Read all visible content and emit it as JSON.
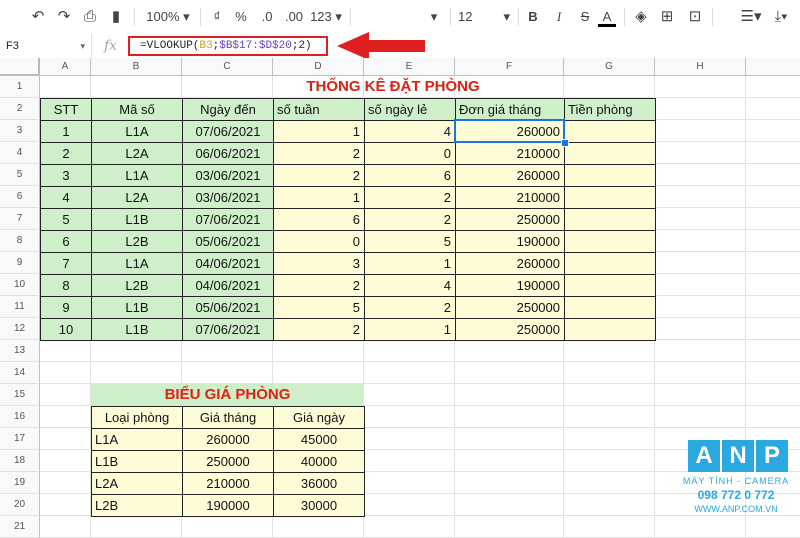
{
  "toolbar": {
    "zoom": "100%",
    "currency": "₫",
    "percent": "%",
    "dec_decrease": ".0",
    "dec_increase": ".00",
    "more_formats": "123",
    "font_size": "12",
    "bold": "B",
    "italic": "I",
    "strike": "S",
    "text_color": "A"
  },
  "formula_bar": {
    "cell_ref": "F3",
    "fx": "fx",
    "formula_prefix": "=VLOOKUP(",
    "formula_ref1": "B3",
    "formula_sep": ";",
    "formula_ref2": "$B$17:$D$20",
    "formula_suffix": ";2)"
  },
  "columns": [
    "A",
    "B",
    "C",
    "D",
    "E",
    "F",
    "G",
    "H"
  ],
  "rows": [
    "1",
    "2",
    "3",
    "4",
    "5",
    "6",
    "7",
    "8",
    "9",
    "10",
    "11",
    "12",
    "13",
    "14",
    "15",
    "16",
    "17",
    "18",
    "19",
    "20",
    "21"
  ],
  "main_table": {
    "title": "THỐNG KÊ ĐẶT PHÒNG",
    "headers": [
      "STT",
      "Mã số",
      "Ngày đến",
      "số tuần",
      "số ngày lẻ",
      "Đơn giá tháng",
      "Tiền phòng"
    ],
    "rows": [
      [
        "1",
        "L1A",
        "07/06/2021",
        "1",
        "4",
        "260000",
        ""
      ],
      [
        "2",
        "L2A",
        "06/06/2021",
        "2",
        "0",
        "210000",
        ""
      ],
      [
        "3",
        "L1A",
        "03/06/2021",
        "2",
        "6",
        "260000",
        ""
      ],
      [
        "4",
        "L2A",
        "03/06/2021",
        "1",
        "2",
        "210000",
        ""
      ],
      [
        "5",
        "L1B",
        "07/06/2021",
        "6",
        "2",
        "250000",
        ""
      ],
      [
        "6",
        "L2B",
        "05/06/2021",
        "0",
        "5",
        "190000",
        ""
      ],
      [
        "7",
        "L1A",
        "04/06/2021",
        "3",
        "1",
        "260000",
        ""
      ],
      [
        "8",
        "L2B",
        "04/06/2021",
        "2",
        "4",
        "190000",
        ""
      ],
      [
        "9",
        "L1B",
        "05/06/2021",
        "5",
        "2",
        "250000",
        ""
      ],
      [
        "10",
        "L1B",
        "07/06/2021",
        "2",
        "1",
        "250000",
        ""
      ]
    ]
  },
  "price_table": {
    "title": "BIỂU GIÁ PHÒNG",
    "headers": [
      "Loại phòng",
      "Giá tháng",
      "Giá ngày"
    ],
    "rows": [
      [
        "L1A",
        "260000",
        "45000"
      ],
      [
        "L1B",
        "250000",
        "40000"
      ],
      [
        "L2A",
        "210000",
        "36000"
      ],
      [
        "L2B",
        "190000",
        "30000"
      ]
    ]
  },
  "logo": {
    "letters": [
      "A",
      "N",
      "P"
    ],
    "tagline": "MÁY TÍNH - CAMERA",
    "phone": "098 772 0 772",
    "site": "WWW.ANP.COM.VN"
  },
  "colors": {
    "header_green": "#cfefcb",
    "data_yellow": "#fefbd7",
    "title_red": "#e02010",
    "annotation_red": "#e02020",
    "selection_blue": "#1a73e8",
    "logo_blue": "#29a9e0"
  }
}
